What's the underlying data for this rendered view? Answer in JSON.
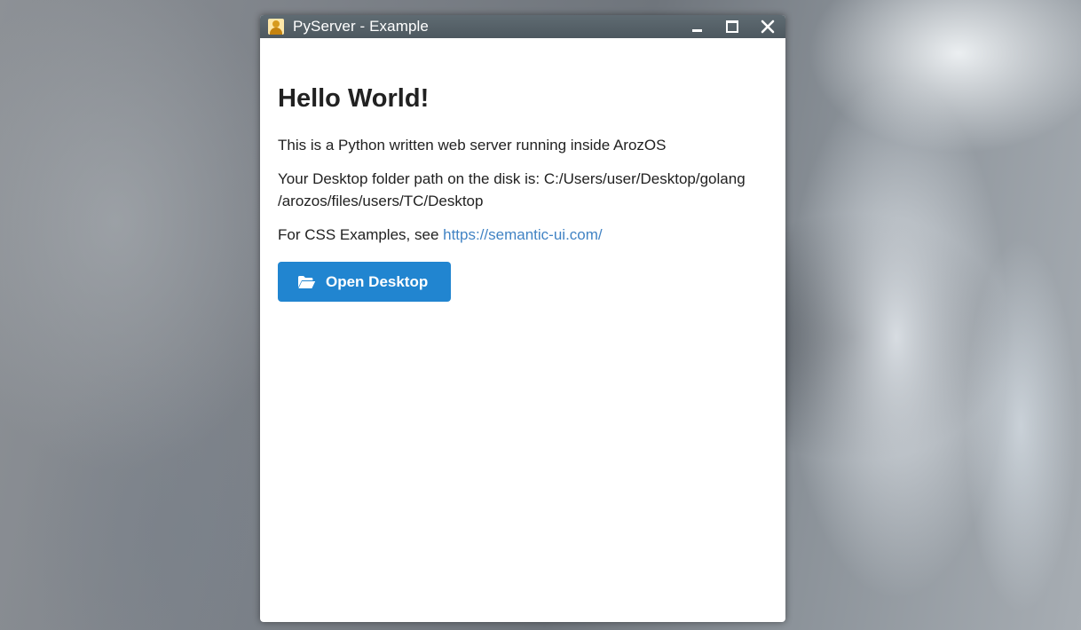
{
  "window": {
    "title": "PyServer - Example",
    "controls": {
      "minimize_icon": "minimize-icon",
      "maximize_icon": "maximize-icon",
      "close_icon": "close-icon"
    }
  },
  "page": {
    "heading": "Hello World!",
    "intro": "This is a Python written web server running inside ArozOS",
    "desktop_path_text": "Your Desktop folder path on the disk is: C:/Users/user/Desktop/golang /arozos/files/users/TC/Desktop",
    "css_prefix": "For CSS Examples, see ",
    "css_link": "https://semantic-ui.com/",
    "open_button": {
      "label": "Open Desktop",
      "icon": "folder-open-icon"
    }
  },
  "colors": {
    "titlebar": "#56626a",
    "button": "#2185d0",
    "link": "#4183c4",
    "text": "#212121"
  }
}
